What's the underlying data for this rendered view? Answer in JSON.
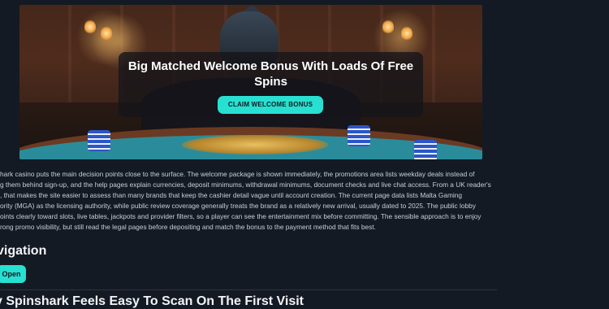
{
  "hero": {
    "title": "Big Matched Welcome Bonus With Loads Of Free Spins",
    "cta_label": "CLAIM WELCOME BONUS"
  },
  "intro_lines": [
    "hark casino puts the main decision points close to the surface. The welcome package is shown immediately, the promotions area lists weekday deals instead of",
    "g them behind sign-up, and the help pages explain currencies, deposit minimums, withdrawal minimums, document checks and live chat access. From a UK reader's",
    ", that makes the site easier to assess than many brands that keep the cashier detail vague until account creation. The current page data lists Malta Gaming",
    "ority (MGA) as the licensing authority, while public review coverage generally treats the brand as a relatively new arrival, usually dated to 2025. The public lobby",
    "oints clearly toward slots, live tables, jackpots and provider filters, so a player can see the entertainment mix before committing. The sensible approach is to enjoy",
    "rong promo visibility, but still read the legal pages before depositing and match the bonus to the payment method that fits best."
  ],
  "nav": {
    "heading": "vigation",
    "open_label": "Open"
  },
  "next_heading": "y Spinshark Feels Easy To Scan On The First Visit",
  "colors": {
    "background": "#141a24",
    "accent": "#28e0d2"
  }
}
